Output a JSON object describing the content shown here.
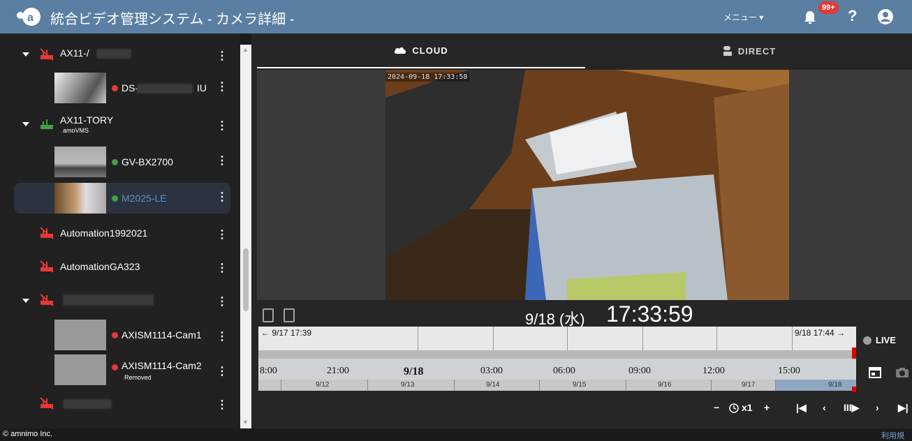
{
  "header": {
    "app_title": "統合ビデオ管理システム - カメラ詳細 -",
    "menu_label": "メニュー ▾",
    "notification_badge": "99+",
    "help_label": "?"
  },
  "sidebar": {
    "items": [
      {
        "name": "AX11-/"
      },
      {
        "name": "DS-",
        "suffix": "IU",
        "status": "offline"
      },
      {
        "name": "AX11-TORY",
        "sub": "amoVMS"
      },
      {
        "name": "GV-BX2700",
        "status": "online"
      },
      {
        "name": "M2025-LE",
        "status": "online",
        "selected": true
      },
      {
        "name": "Automation1992021"
      },
      {
        "name": "AutomationGA323"
      },
      {
        "name": ""
      },
      {
        "name": "AXISM1114-Cam1",
        "status": "offline"
      },
      {
        "name": "AXISM1114-Cam2",
        "sub": "Removed",
        "status": "offline"
      },
      {
        "name": ""
      }
    ]
  },
  "tabs": {
    "cloud": "CLOUD",
    "direct": "DIRECT"
  },
  "video": {
    "timestamp": "2024-09-18 17:33:58"
  },
  "playback": {
    "date": "9/18 (水)",
    "time": "17:33:59",
    "range_start": "← 9/17 17:39",
    "range_end": "9/18 17:44 →",
    "hours": [
      "8:00",
      "21:00",
      "9/18",
      "03:00",
      "06:00",
      "09:00",
      "12:00",
      "15:00"
    ],
    "days": [
      "9/12",
      "9/13",
      "9/14",
      "9/15",
      "9/16",
      "9/17",
      "9/18"
    ],
    "live_label": "LIVE",
    "speed_label": "x1",
    "speed_minus": "−",
    "speed_plus": "+"
  },
  "footer": {
    "copyright": "© amnimo Inc.",
    "terms": "利用規"
  },
  "colors": {
    "header": "#5a7fa3",
    "offline": "#e53935",
    "online": "#43a047",
    "selected_text": "#5d8fc0"
  }
}
